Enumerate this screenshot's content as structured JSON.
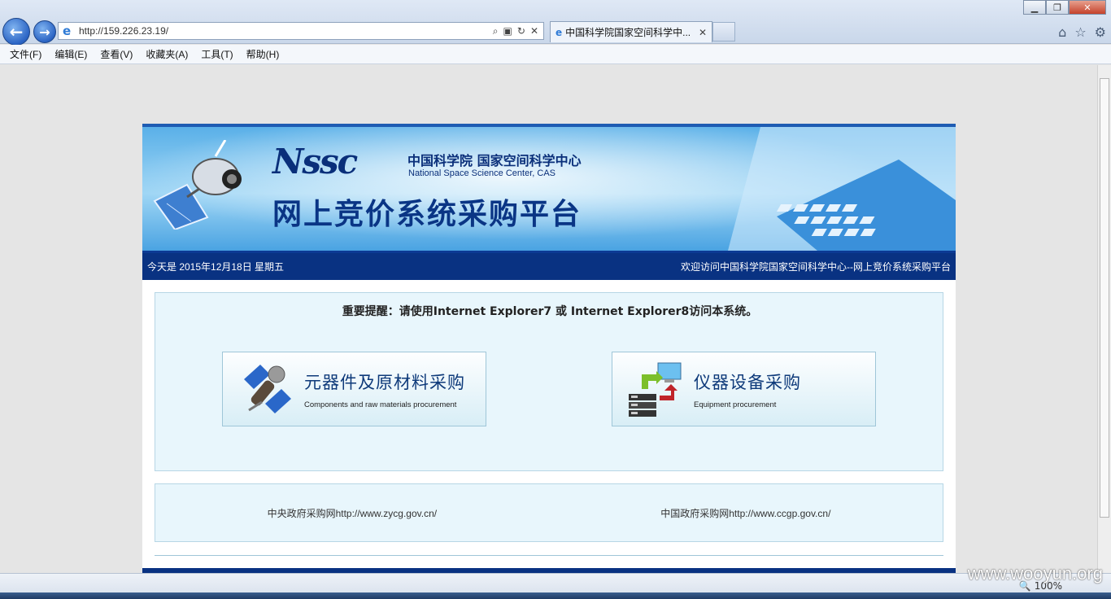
{
  "browser": {
    "url": "http://159.226.23.19/",
    "tab_title": "中国科学院国家空间科学中...",
    "menu": [
      "文件(F)",
      "编辑(E)",
      "查看(V)",
      "收藏夹(A)",
      "工具(T)",
      "帮助(H)"
    ],
    "zoom": "100%"
  },
  "banner": {
    "logo": "Nssc",
    "org_cn": "中国科学院 国家空间科学中心",
    "org_en": "National Space Science Center, CAS",
    "platform": "网上竞价系统采购平台"
  },
  "infobar": {
    "date_text": "今天是  2015年12月18日 星期五",
    "welcome": "欢迎访问中国科学院国家空间科学中心--网上竞价系统采购平台"
  },
  "notice": "重要提醒：请使用Internet Explorer7 或  Internet Explorer8访问本系统。",
  "cards": [
    {
      "title": "元器件及原材料采购",
      "subtitle": "Components and raw materials procurement"
    },
    {
      "title": "仪器设备采购",
      "subtitle": "Equipment procurement"
    }
  ],
  "links": [
    {
      "label": "中央政府采购网http://www.zycg.gov.cn/"
    },
    {
      "label": "中国政府采购网http://www.ccgp.gov.cn/"
    }
  ],
  "watermark": "www.wooyun.org",
  "colors": {
    "header_blue": "#093282",
    "panel_bg": "#e8f6fc",
    "title_blue": "#0e3a7a"
  }
}
